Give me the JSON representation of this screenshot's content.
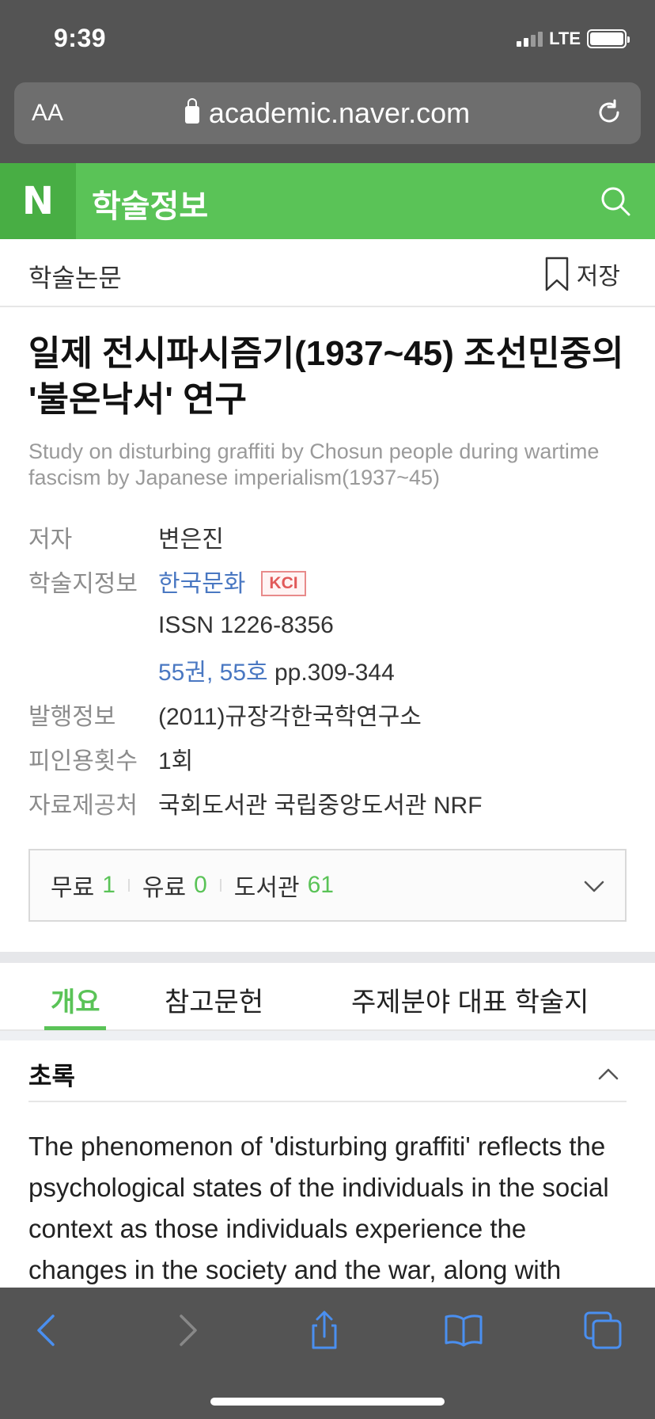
{
  "status": {
    "time": "9:39",
    "network": "LTE"
  },
  "browser": {
    "text_size_label": "AA",
    "url": "academic.naver.com"
  },
  "header": {
    "logo": "N",
    "site_title": "학술정보"
  },
  "subheader": {
    "section": "학술논문",
    "save_label": "저장"
  },
  "article": {
    "title": "일제 전시파시즘기(1937~45) 조선민중의 '불온낙서' 연구",
    "subtitle": "Study on disturbing graffiti by Chosun people during wartime fascism by Japanese imperialism(1937~45)",
    "info": {
      "author_label": "저자",
      "author": "변은진",
      "journal_label": "학술지정보",
      "journal": "한국문화",
      "kci": "KCI",
      "issn": "ISSN 1226-8356",
      "volume_issue": "55권, 55호",
      "pages": "pp.309-344",
      "pub_label": "발행정보",
      "pub_info": "(2011)규장각한국학연구소",
      "cited_label": "피인용횟수",
      "cited": "1회",
      "provider_label": "자료제공처",
      "providers": "국회도서관 국립중앙도서관 NRF"
    }
  },
  "access": {
    "free_label": "무료",
    "free_count": "1",
    "paid_label": "유료",
    "paid_count": "0",
    "library_label": "도서관",
    "library_count": "61"
  },
  "tabs": [
    {
      "label": "개요"
    },
    {
      "label": "참고문헌"
    },
    {
      "label": "주제분야 대표 학술지"
    }
  ],
  "abstract": {
    "heading": "초록",
    "text": "The phenomenon of 'disturbing graffiti' reflects the psychological states of the individuals in the social context as those individuals experience the changes in the society and the war, along with"
  },
  "colors": {
    "naver_green": "#5ac357",
    "link_blue": "#4a78c2",
    "provider_blue": "#1b1bd0",
    "browser_chrome": "#545454"
  },
  "icons": [
    "lock-icon",
    "reload-icon",
    "search-icon",
    "bookmark-icon",
    "chevron-down-icon",
    "chevron-up-icon",
    "back-icon",
    "forward-icon",
    "share-icon",
    "bookmarks-icon",
    "tabs-icon"
  ]
}
